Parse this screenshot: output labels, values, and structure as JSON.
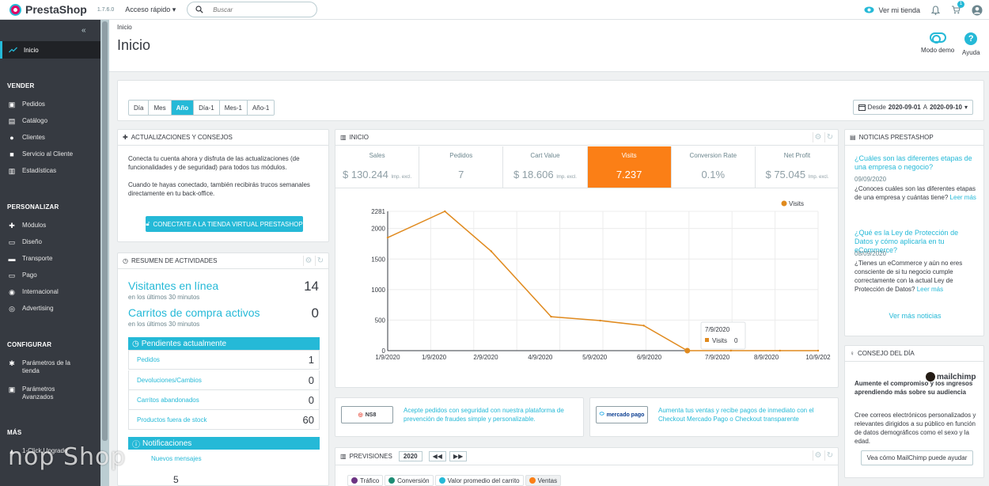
{
  "topbar": {
    "brand": "PrestaShop",
    "version": "1.7.6.0",
    "quick_access": "Acceso rápido ▾",
    "search_placeholder": "Buscar",
    "view_store": "Ver mi tienda",
    "orders_badge": "1"
  },
  "sidebar": {
    "active": "Inicio",
    "sections": [
      {
        "title": "VENDER",
        "items": [
          "Pedidos",
          "Catálogo",
          "Clientes",
          "Servicio al Cliente",
          "Estadísticas"
        ]
      },
      {
        "title": "PERSONALIZAR",
        "items": [
          "Módulos",
          "Diseño",
          "Transporte",
          "Pago",
          "Internacional",
          "Advertising"
        ]
      },
      {
        "title": "CONFIGURAR",
        "items": [
          "Parámetros de la tienda",
          "Parámetros Avanzados"
        ]
      },
      {
        "title": "MÁS",
        "items": [
          "1-Click Upgrade"
        ]
      }
    ]
  },
  "header": {
    "breadcrumb": "Inicio",
    "title": "Inicio",
    "demo_mode": "Modo demo",
    "help": "Ayuda"
  },
  "periods": [
    "Día",
    "Mes",
    "Año",
    "Día-1",
    "Mes-1",
    "Año-1"
  ],
  "active_period": "Año",
  "date_range": {
    "prefix": "Desde",
    "from": "2020-09-01",
    "sep": "A",
    "to": "2020-09-10"
  },
  "updates": {
    "title": "ACTUALIZACIONES Y CONSEJOS",
    "p1": "Conecta tu cuenta ahora y disfruta de las actualizaciones (de funcionalidades y de seguridad) para todos tus módulos.",
    "p2": "Cuando te hayas conectado, también recibirás trucos semanales directamente en tu back-office.",
    "button": "CONECTATE A LA TIENDA VIRTUAL PRESTASHOP"
  },
  "activity": {
    "title": "RESUMEN DE ACTIVIDADES",
    "visitors_label": "Visitantes en línea",
    "visitors_value": "14",
    "visitors_sub": "en los últimos 30 minutos",
    "carts_label": "Carritos de compra activos",
    "carts_value": "0",
    "carts_sub": "en los últimos 30 minutos",
    "pending_title": "Pendientes actualmente",
    "pending": [
      {
        "label": "Pedidos",
        "value": "1"
      },
      {
        "label": "Devoluciones/Cambios",
        "value": "0"
      },
      {
        "label": "Carritos abandonados",
        "value": "0"
      },
      {
        "label": "Productos fuera de stock",
        "value": "60"
      }
    ],
    "notif_title": "Notificaciones",
    "new_messages": "Nuevos mensajes",
    "new_messages_value": "5"
  },
  "dashboard": {
    "title": "INICIO",
    "kpis": [
      {
        "label": "Sales",
        "value": "$ 130.244",
        "suffix": "Imp. excl."
      },
      {
        "label": "Pedidos",
        "value": "7",
        "suffix": ""
      },
      {
        "label": "Cart Value",
        "value": "$ 18.606",
        "suffix": "Imp. excl."
      },
      {
        "label": "Visits",
        "value": "7.237",
        "suffix": ""
      },
      {
        "label": "Conversion Rate",
        "value": "0.1%",
        "suffix": ""
      },
      {
        "label": "Net Profit",
        "value": "$ 75.045",
        "suffix": "Imp. excl."
      }
    ],
    "active_kpi": "Visits",
    "tooltip_date": "7/9/2020",
    "tooltip_series": "Visits",
    "tooltip_value": "0"
  },
  "chart_data": {
    "type": "line",
    "series": [
      {
        "name": "Visits",
        "color": "#e08a1e",
        "values": [
          1851,
          2281,
          1627,
          556,
          492,
          410,
          0,
          0,
          0,
          0,
          0
        ]
      }
    ],
    "x": [
      0,
      1,
      2,
      3,
      4,
      5,
      6,
      7,
      8,
      9,
      10
    ],
    "x_tick_labels": [
      "1/9/2020",
      "1/9/2020",
      "2/9/2020",
      "4/9/2020",
      "5/9/2020",
      "6/9/2020",
      "7/9/2020",
      "8/9/2020",
      "10/9/202"
    ],
    "y_ticks": [
      "0",
      "500",
      "1000",
      "1500",
      "2000",
      "2281"
    ],
    "ylim": [
      0,
      2281
    ],
    "grid": true,
    "legend_position": "top-right"
  },
  "news": {
    "title": "NOTICIAS PRESTASHOP",
    "items": [
      {
        "title": "¿Cuáles son las diferentes etapas de una empresa o negocio?",
        "date": "09/09/2020",
        "text": "¿Conoces cuáles son las diferentes etapas de una empresa y cuántas tiene?",
        "more": "Leer más"
      },
      {
        "title": "¿Qué es la Ley de Protección de Datos y cómo aplicarla en tu eCommerce?",
        "date": "08/09/2020",
        "text": "¿Tienes un eCommerce y aún no eres consciente de si tu negocio cumple correctamente con la actual Ley de Protección de Datos?",
        "more": "Leer más"
      }
    ],
    "more_news": "Ver más noticias"
  },
  "tip": {
    "title": "CONSEJO DEL DÍA",
    "headline": "Aumente el compromiso y los ingresos aprendiendo más sobre su audiencia",
    "brand": "mailchimp",
    "text": "Cree correos electrónicos personalizados y relevantes dirigidos a su público en función de datos demográficos como el sexo y la edad.",
    "button": "Vea cómo MailChimp puede ayudar"
  },
  "partners": [
    {
      "logo": "NS8",
      "text": "Acepte pedidos con seguridad con nuestra plataforma de prevención de fraudes simple y personalizable."
    },
    {
      "logo": "mercado pago",
      "text": "Aumenta tus ventas y recibe pagos de inmediato con el Checkout Mercado Pago o Checkout transparente"
    }
  ],
  "forecast": {
    "title": "PREVISIONES",
    "year": "2020",
    "tabs": [
      {
        "label": "Tráfico",
        "color": "#6c3483"
      },
      {
        "label": "Conversión",
        "color": "#1e8c74"
      },
      {
        "label": "Valor promedio del carrito",
        "color": "#25b9d7"
      },
      {
        "label": "Ventas",
        "color": "#fb7f16"
      }
    ]
  },
  "watermark": "nop Shop"
}
